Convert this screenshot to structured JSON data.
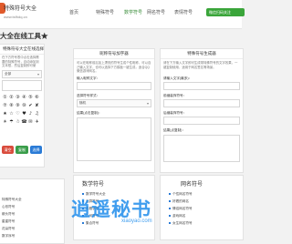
{
  "header": {
    "site_name": "特殊符号大全",
    "site_url": "www.tsfhdq.cn",
    "nav": [
      "首页",
      "特殊符号",
      "数学符号",
      "网名符号",
      "表情符号"
    ],
    "wechat_label": "微信扫码关注"
  },
  "page_heading": "大全在线工具★",
  "sidebar": {
    "title": "特殊符号大全在线选择器",
    "description": "在下方符号表中点击选择需要的特殊符号，自动添加到文本框，然后复制即可使用，方便快捷。",
    "select_value": "全部",
    "input_placeholder": "输入或点击符号",
    "symbols_row1": [
      "①",
      "②",
      "③",
      "④",
      "⑤",
      "⑥"
    ],
    "symbols_row2": [
      "⑦",
      "⑧",
      "⑨",
      "⑩",
      "✔",
      "✘"
    ],
    "symbols_row3": [
      "★",
      "☆",
      "♡",
      "♥",
      "♪",
      "♫"
    ],
    "symbols_row4": [
      "☀",
      "☂",
      "☃",
      "☎",
      "✉",
      "✈"
    ],
    "buttons": [
      "清空",
      "复制",
      "选择"
    ]
  },
  "center_panel": {
    "title": "昵称符号加字器",
    "description": "可以在昵称前后加上漂亮的符号生成个性昵称，可以自己输入文字，也可以选择下方模板一键生成，适合QQ微信游戏网名。",
    "name_label": "输入昵称文字：",
    "style_label": "选择符号样式：",
    "style_value": "随机",
    "result_label": "结果(点击复制)："
  },
  "right_panel": {
    "title": "特殊符号生成器",
    "description": "请在下方输入文字即可生成带特殊符号的文字效果，一键复制使用，适用于网名签名等场景。",
    "input_label": "请输入文字(最多)：",
    "prefix_label": "前缀装饰符号：",
    "suffix_label": "后缀装饰符号：",
    "result_label": "结果(点复制)："
  },
  "lists": {
    "left_items": [
      "特殊符号大全",
      "心形符号",
      "箭头符号",
      "星星符号",
      "花朵符号",
      "数字序号"
    ],
    "math_title": "数学符号",
    "math_items": [
      "数学符号大全",
      "运算符号",
      "希腊字母",
      "几何符号",
      "集合符号"
    ],
    "netname_title": "网名符号",
    "netname_items": [
      "个性网名符号",
      "好看的网名",
      "情侣网名符号",
      "游戏网名",
      "女生网名符号"
    ]
  },
  "watermark": {
    "text": "逍遥秘书",
    "url": "xiaoyao.com"
  },
  "colors": {
    "accent": "#3a8d3a",
    "blue": "#2a7bd6",
    "red_button": "#d94c3d",
    "green_button": "#3a9d4a",
    "watermark": "#1e8ceb"
  }
}
